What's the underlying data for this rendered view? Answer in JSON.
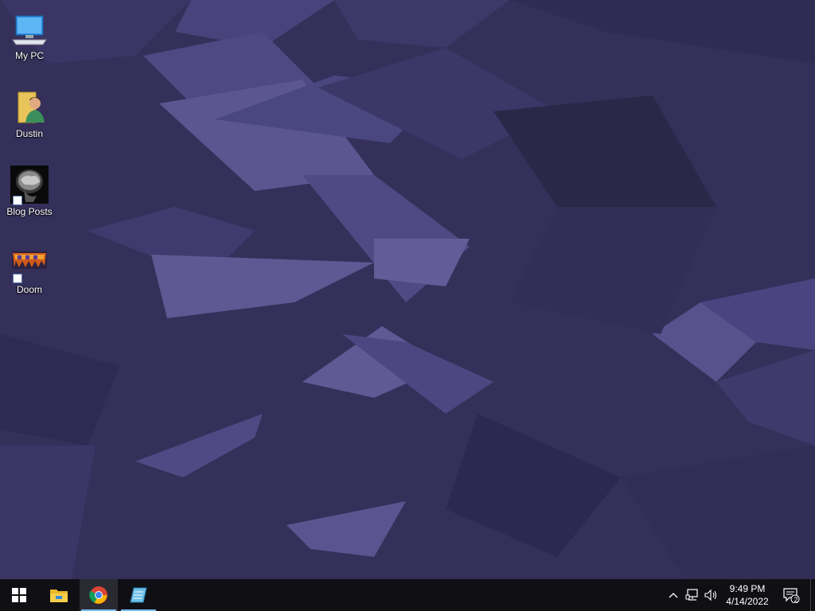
{
  "desktop": {
    "icons": [
      {
        "label": "My PC",
        "icon": "computer-icon"
      },
      {
        "label": "Dustin",
        "icon": "user-folder-icon"
      },
      {
        "label": "Blog Posts",
        "icon": "brain-scan-icon"
      },
      {
        "label": "Doom",
        "icon": "doom-logo-icon"
      }
    ],
    "wallpaper": {
      "base_color": "#34305a",
      "accent_light": "#5d5888",
      "accent_dark": "#26223f"
    }
  },
  "taskbar": {
    "apps": [
      {
        "name": "start",
        "icon": "windows-start-icon"
      },
      {
        "name": "file-explorer",
        "icon": "file-explorer-icon"
      },
      {
        "name": "chrome",
        "icon": "chrome-icon",
        "active": true
      },
      {
        "name": "notepad",
        "icon": "notepad-icon",
        "running": true
      }
    ],
    "tray": {
      "icons": [
        "chevron-up-icon",
        "network-icon",
        "volume-icon"
      ],
      "time": "9:49 PM",
      "date": "4/14/2022",
      "notification_count": "2"
    },
    "background": "#101014"
  }
}
